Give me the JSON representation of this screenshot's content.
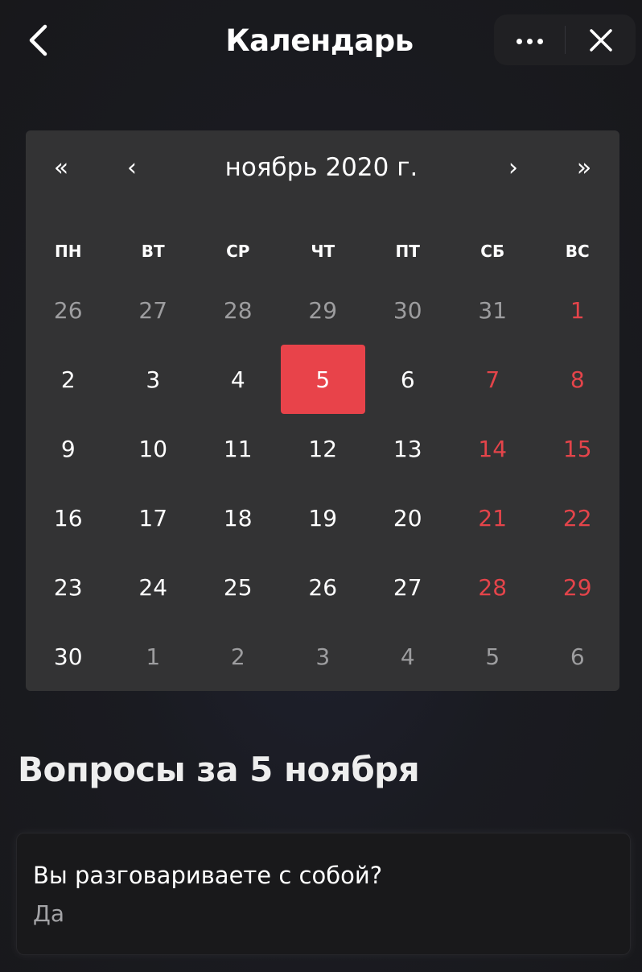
{
  "header": {
    "title": "Календарь",
    "back_icon": "chevron-left-icon",
    "more_icon": "more-dots-icon",
    "close_icon": "close-icon"
  },
  "calendar": {
    "prev_year_label": "«",
    "prev_month_label": "‹",
    "month_label": "ноябрь 2020 г.",
    "next_month_label": "›",
    "next_year_label": "»",
    "weekdays": [
      "ПН",
      "ВТ",
      "СР",
      "ЧТ",
      "ПТ",
      "СБ",
      "ВС"
    ],
    "days": [
      {
        "label": "26",
        "type": "outside"
      },
      {
        "label": "27",
        "type": "outside"
      },
      {
        "label": "28",
        "type": "outside"
      },
      {
        "label": "29",
        "type": "outside"
      },
      {
        "label": "30",
        "type": "outside"
      },
      {
        "label": "31",
        "type": "outside"
      },
      {
        "label": "1",
        "type": "weekend"
      },
      {
        "label": "2",
        "type": "normal"
      },
      {
        "label": "3",
        "type": "normal"
      },
      {
        "label": "4",
        "type": "normal"
      },
      {
        "label": "5",
        "type": "selected"
      },
      {
        "label": "6",
        "type": "normal"
      },
      {
        "label": "7",
        "type": "weekend"
      },
      {
        "label": "8",
        "type": "weekend"
      },
      {
        "label": "9",
        "type": "normal"
      },
      {
        "label": "10",
        "type": "normal"
      },
      {
        "label": "11",
        "type": "normal"
      },
      {
        "label": "12",
        "type": "normal"
      },
      {
        "label": "13",
        "type": "normal"
      },
      {
        "label": "14",
        "type": "weekend"
      },
      {
        "label": "15",
        "type": "weekend"
      },
      {
        "label": "16",
        "type": "normal"
      },
      {
        "label": "17",
        "type": "normal"
      },
      {
        "label": "18",
        "type": "normal"
      },
      {
        "label": "19",
        "type": "normal"
      },
      {
        "label": "20",
        "type": "normal"
      },
      {
        "label": "21",
        "type": "weekend"
      },
      {
        "label": "22",
        "type": "weekend"
      },
      {
        "label": "23",
        "type": "normal"
      },
      {
        "label": "24",
        "type": "normal"
      },
      {
        "label": "25",
        "type": "normal"
      },
      {
        "label": "26",
        "type": "normal"
      },
      {
        "label": "27",
        "type": "normal"
      },
      {
        "label": "28",
        "type": "weekend"
      },
      {
        "label": "29",
        "type": "weekend"
      },
      {
        "label": "30",
        "type": "normal"
      },
      {
        "label": "1",
        "type": "outside"
      },
      {
        "label": "2",
        "type": "outside"
      },
      {
        "label": "3",
        "type": "outside"
      },
      {
        "label": "4",
        "type": "outside"
      },
      {
        "label": "5",
        "type": "outside"
      },
      {
        "label": "6",
        "type": "outside"
      }
    ]
  },
  "questions": {
    "title": "Вопросы за 5 ноября",
    "items": [
      {
        "question": "Вы разговариваете с собой?",
        "answer": "Да"
      }
    ]
  },
  "colors": {
    "accent": "#e8434a",
    "weekend": "#e4444a",
    "calendar_bg": "#333334",
    "page_bg": "#1a1b21"
  }
}
